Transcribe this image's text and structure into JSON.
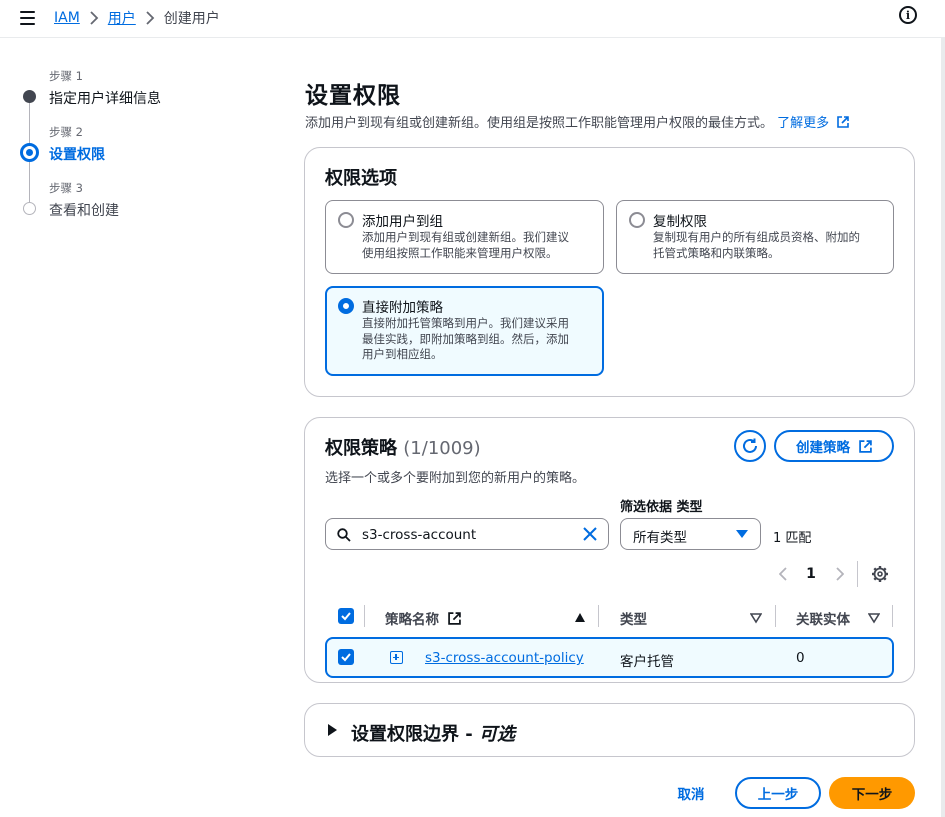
{
  "breadcrumb": {
    "items": [
      "IAM",
      "用户"
    ],
    "current": "创建用户"
  },
  "steps": [
    {
      "num": "步骤 1",
      "label": "指定用户详细信息"
    },
    {
      "num": "步骤 2",
      "label": "设置权限"
    },
    {
      "num": "步骤 3",
      "label": "查看和创建"
    }
  ],
  "page": {
    "title": "设置权限",
    "description": "添加用户到现有组或创建新组。使用组是按照工作职能管理用户权限的最佳方式。",
    "learn_more": "了解更多"
  },
  "permission_options": {
    "title": "权限选项",
    "options": [
      {
        "title": "添加用户到组",
        "desc1": "添加用户到现有组或创建新组。我们建议",
        "desc2": "使用组按照工作职能来管理用户权限。"
      },
      {
        "title": "复制权限",
        "desc1": "复制现有用户的所有组成员资格、附加的",
        "desc2": "托管式策略和内联策略。"
      },
      {
        "title": "直接附加策略",
        "desc1": "直接附加托管策略到用户。我们建议采用",
        "desc2": "最佳实践，即附加策略到组。然后，添加",
        "desc3": "用户到相应组。"
      }
    ],
    "selected": "直接附加策略"
  },
  "policies": {
    "title": "权限策略",
    "count": "(1/1009)",
    "description": "选择一个或多个要附加到您的新用户的策略。",
    "create_button": "创建策略",
    "search_value": "s3-cross-account",
    "filter_label": "筛选依据 类型",
    "filter_value": "所有类型",
    "match_count": "1 匹配",
    "page_number": "1",
    "columns": [
      "策略名称",
      "类型",
      "关联实体"
    ],
    "rows": [
      {
        "name": "s3-cross-account-policy",
        "type": "客户托管",
        "entities": "0",
        "checked": true
      }
    ]
  },
  "boundary": {
    "title": "设置权限边界 - ",
    "optional": "可选"
  },
  "footer": {
    "cancel": "取消",
    "previous": "上一步",
    "next": "下一步"
  },
  "colors": {
    "accent": "#006ce0",
    "primary_button": "#ff9900",
    "selected_bg": "#f0fbff"
  }
}
